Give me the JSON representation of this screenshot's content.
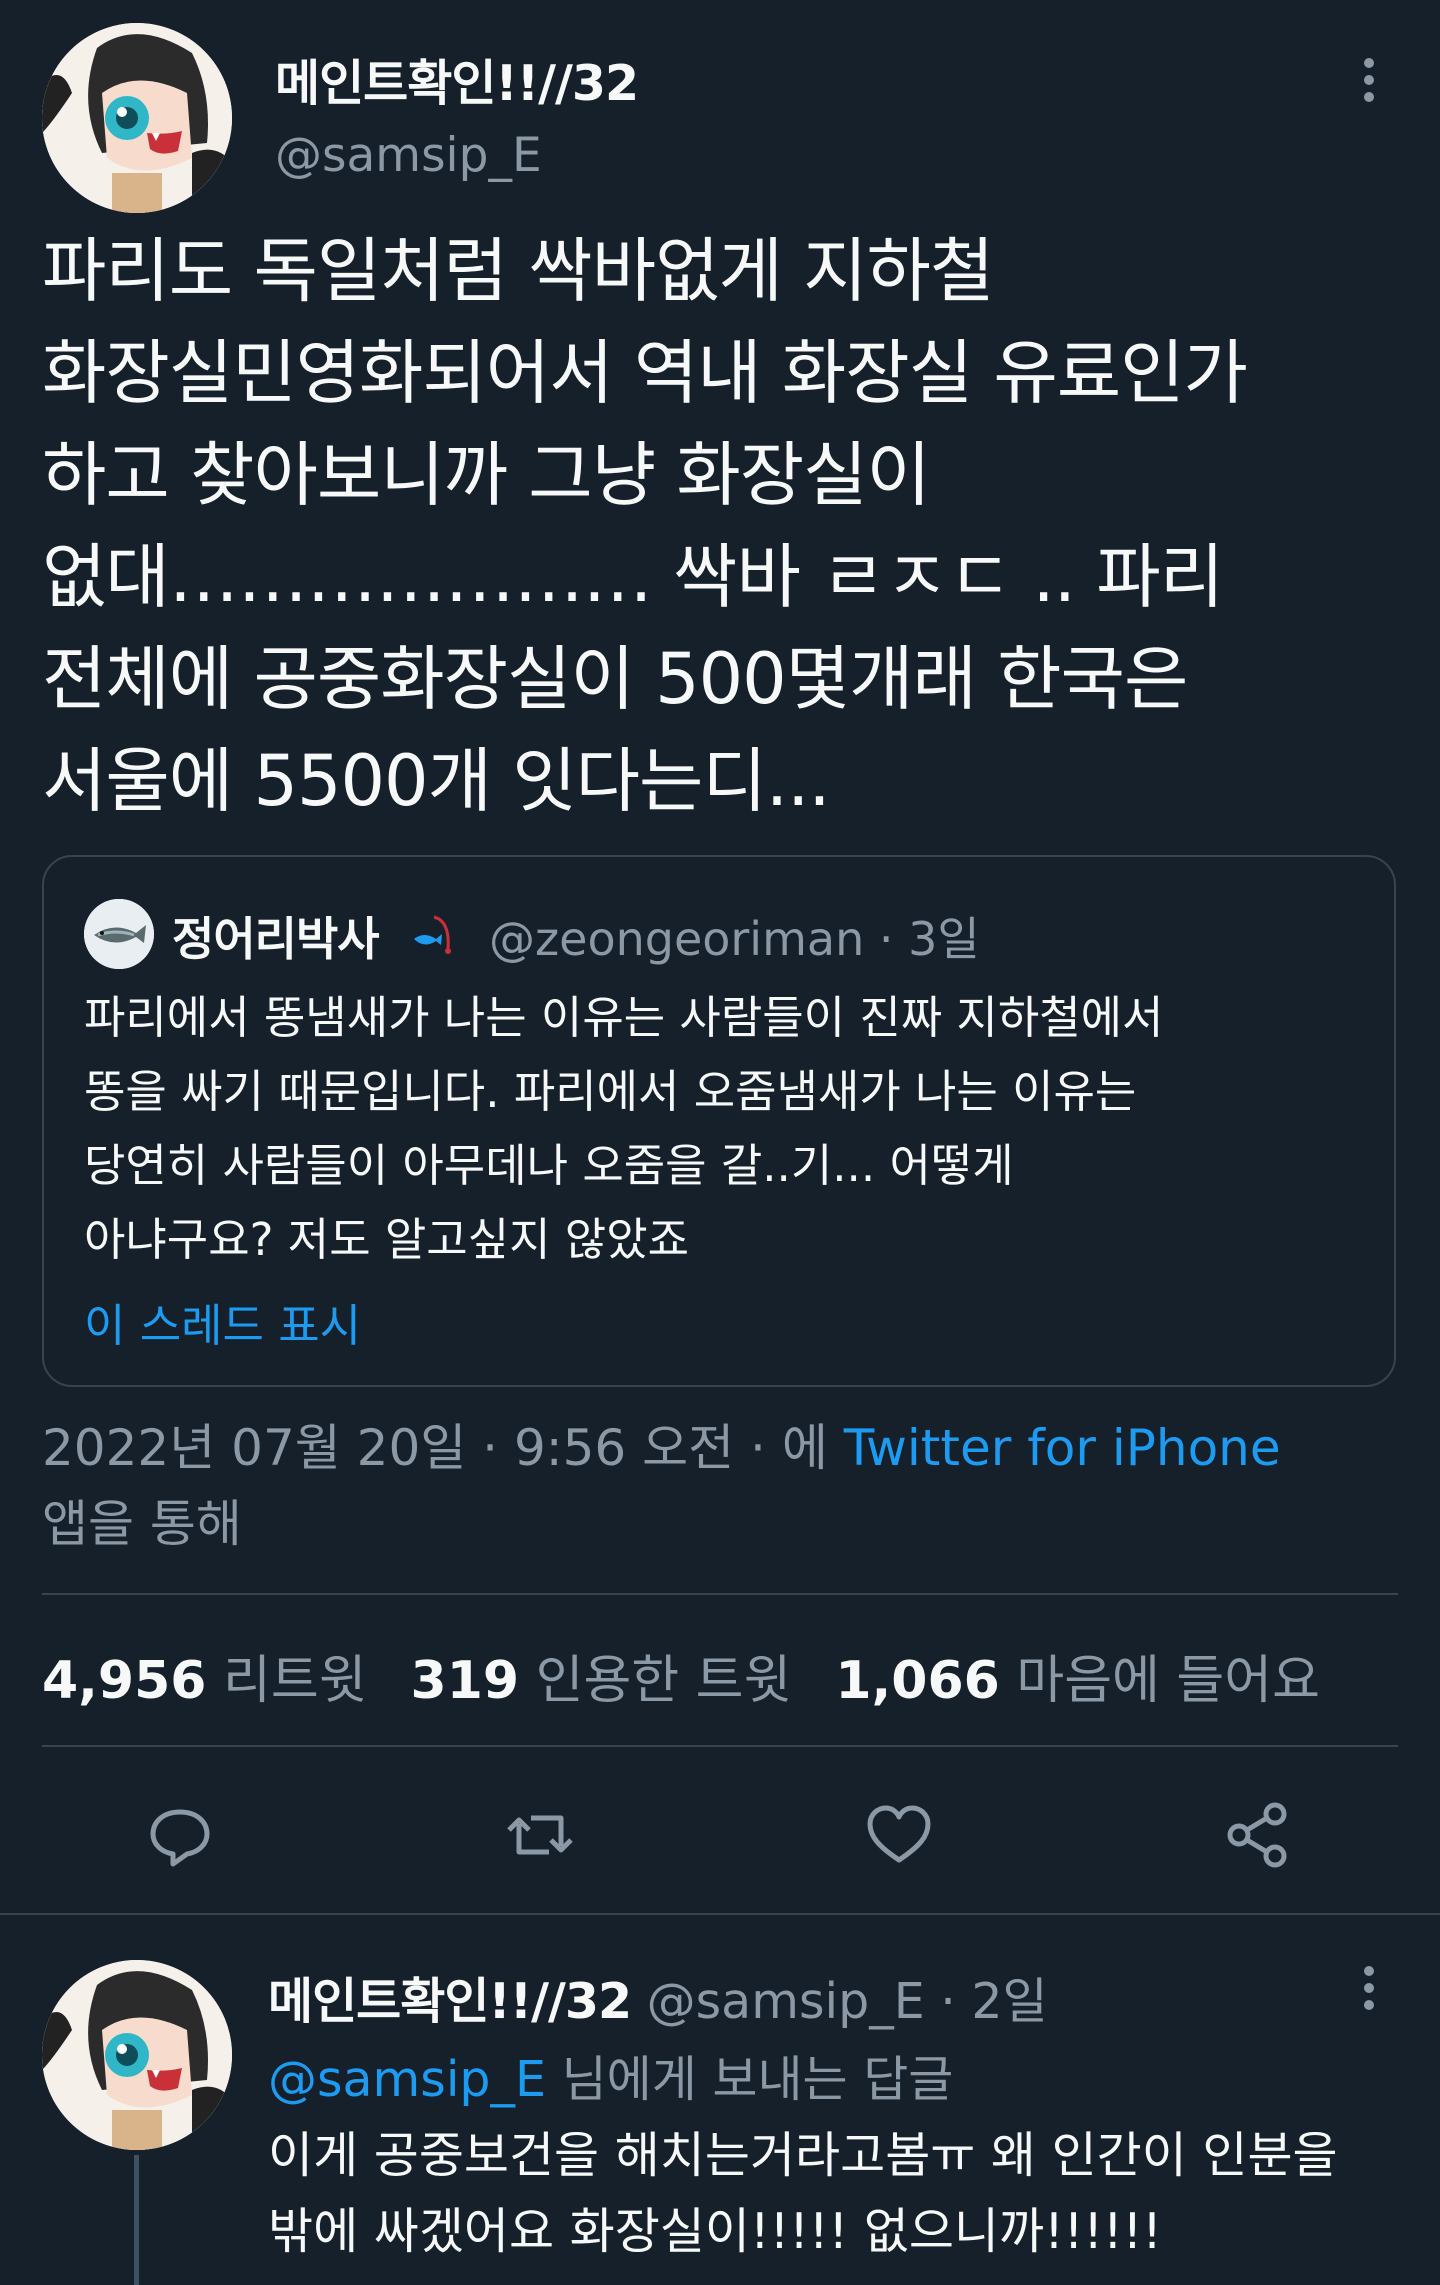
{
  "main_tweet": {
    "author_name": "메인트확인!!//32",
    "handle": "@samsip_E",
    "text_lines": [
      "파리도 독일처럼 싹바없게 지하철",
      "화장실민영화되어서 역내 화장실 유료인가",
      "하고 찾아보니까 그냥 화장실이",
      "없대………………… 싹바 ㄹㅈㄷ .. 파리",
      "전체에 공중화장실이 500몇개래 한국은",
      "서울에 5500개 잇다는디..."
    ],
    "quote": {
      "author_name": "정어리박사",
      "handle_time": "@zeongeoriman · 3일",
      "text_lines": [
        "파리에서 똥냄새가 나는 이유는 사람들이 진짜 지하철에서",
        "똥을 싸기 때문입니다. 파리에서 오줌냄새가 나는 이유는",
        "당연히 사람들이 아무데나 오줌을 갈..기... 어떻게",
        "아냐구요? 저도 알고싶지 않았죠"
      ],
      "show_thread": "이 스레드 표시"
    },
    "timestamp": "2022년 07월 20일 · 9:56 오전 · 에",
    "source": "Twitter for iPhone",
    "source_suffix": "앱을 통해",
    "stats": {
      "retweets_count": "4,956",
      "retweets_label": "리트윗",
      "quotes_count": "319",
      "quotes_label": "인용한 트윗",
      "likes_count": "1,066",
      "likes_label": "마음에 들어요"
    }
  },
  "reply": {
    "author_name": "메인트확인!!//32",
    "handle_time": "@samsip_E · 2일",
    "reply_to_handle": "@samsip_E",
    "reply_to_suffix": "님에게 보내는 답글",
    "text_lines": [
      "이게 공중보건을 해치는거라고봄ㅠ 왜 인간이 인분을",
      "밖에 싸겠어요 화장실이!!!!! 없으니까!!!!!!"
    ]
  },
  "colors": {
    "background": "#15202b",
    "text": "#f7f9f9",
    "muted": "#8b98a5",
    "accent": "#1d9bf0",
    "border": "#38444d"
  },
  "icons": [
    "more-icon",
    "reply-icon",
    "retweet-icon",
    "like-icon",
    "share-icon"
  ]
}
